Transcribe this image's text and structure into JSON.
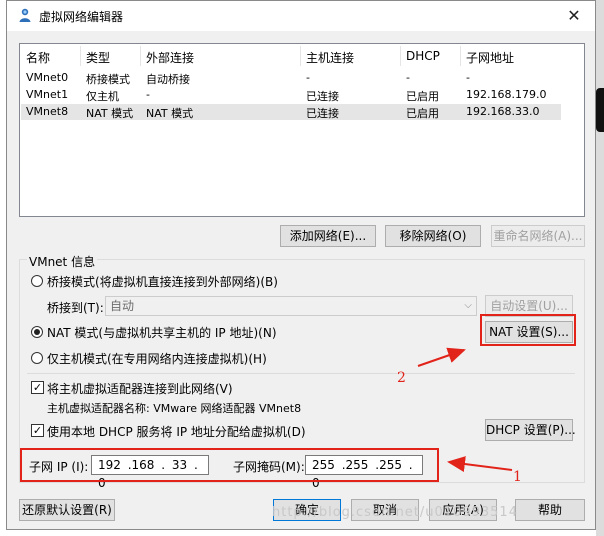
{
  "window": {
    "title": "虚拟网络编辑器",
    "close_glyph": "✕"
  },
  "network_table": {
    "headers": [
      "名称",
      "类型",
      "外部连接",
      "主机连接",
      "DHCP",
      "子网地址"
    ],
    "rows": [
      [
        "VMnet0",
        "桥接模式",
        "自动桥接",
        "-",
        "-",
        "-"
      ],
      [
        "VMnet1",
        "仅主机",
        "-",
        "已连接",
        "已启用",
        "192.168.179.0"
      ],
      [
        "VMnet8",
        "NAT 模式",
        "NAT 模式",
        "已连接",
        "已启用",
        "192.168.33.0"
      ]
    ],
    "selected_row": 2
  },
  "table_buttons": {
    "add": "添加网络(E)...",
    "remove": "移除网络(O)",
    "rename": "重命名网络(A)..."
  },
  "vmnet_info": {
    "title": "VMnet 信息",
    "bridged_label": "桥接模式(将虚拟机直接连接到外部网络)(B)",
    "bridged_to_label": "桥接到(T):",
    "bridged_to_value": "自动",
    "auto_settings": "自动设置(U)...",
    "nat_label": "NAT 模式(与虚拟机共享主机的 IP 地址)(N)",
    "nat_settings": "NAT 设置(S)...",
    "hostonly_label": "仅主机模式(在专用网络内连接虚拟机)(H)",
    "mode_selected": "nat",
    "connect_adapter_label": "将主机虚拟适配器连接到此网络(V)",
    "connect_adapter_checked": true,
    "adapter_name_text": "主机虚拟适配器名称: VMware 网络适配器 VMnet8",
    "dhcp_label": "使用本地 DHCP 服务将 IP 地址分配给虚拟机(D)",
    "dhcp_checked": true,
    "dhcp_settings": "DHCP 设置(P)...",
    "check_glyph": "✓",
    "subnet_ip_label": "子网 IP (I):",
    "subnet_ip_value": "192 .168 . 33 . 0",
    "subnet_mask_label": "子网掩码(M):",
    "subnet_mask_value": "255 .255 .255 . 0"
  },
  "footer": {
    "restore_defaults": "还原默认设置(R)",
    "ok": "确定",
    "cancel": "取消",
    "apply": "应用(A)",
    "help": "帮助"
  },
  "annotations": {
    "label_1": "1",
    "label_2": "2",
    "color": "#e2231a"
  },
  "watermark": "http://blog.csdn.net/u010993514"
}
